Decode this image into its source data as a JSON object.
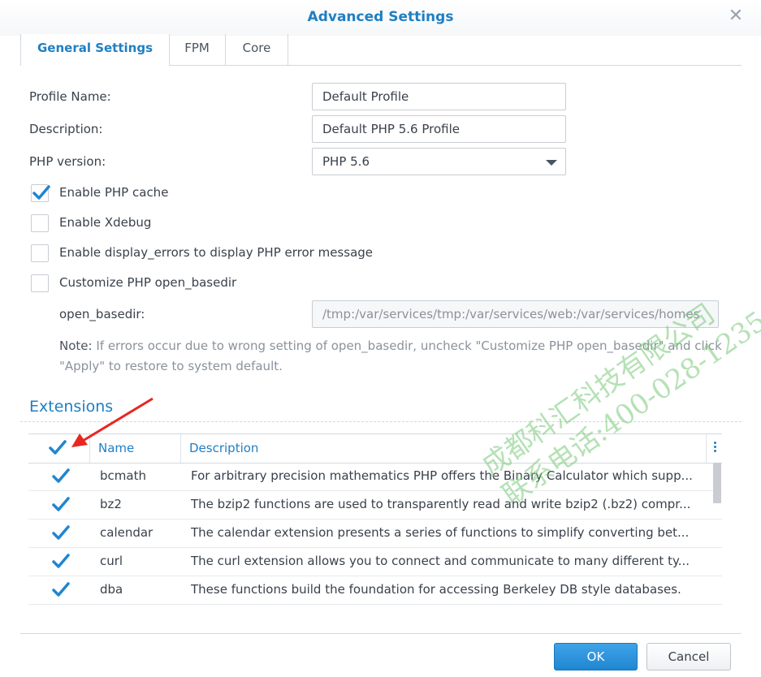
{
  "window": {
    "title": "Advanced Settings"
  },
  "tabs": [
    {
      "label": "General Settings",
      "active": true
    },
    {
      "label": "FPM",
      "active": false
    },
    {
      "label": "Core",
      "active": false
    }
  ],
  "form": {
    "profile_name_label": "Profile Name:",
    "profile_name_value": "Default Profile",
    "description_label": "Description:",
    "description_value": "Default PHP 5.6 Profile",
    "php_version_label": "PHP version:",
    "php_version_value": "PHP 5.6",
    "options": [
      {
        "label": "Enable PHP cache",
        "checked": true
      },
      {
        "label": "Enable Xdebug",
        "checked": false
      },
      {
        "label": "Enable display_errors to display PHP error message",
        "checked": false
      },
      {
        "label": "Customize PHP open_basedir",
        "checked": false
      }
    ],
    "open_basedir_label": "open_basedir:",
    "open_basedir_value": "/tmp:/var/services/tmp:/var/services/web:/var/services/homes",
    "note_head": "Note:",
    "note_line1": "If errors occur due to wrong setting of open_basedir, uncheck \"Customize PHP open_basedir\" and click",
    "note_line2": "\"Apply\" to restore to system default."
  },
  "extensions": {
    "title": "Extensions",
    "columns": [
      "Name",
      "Description"
    ],
    "all_checked": true,
    "rows": [
      {
        "checked": true,
        "name": "bcmath",
        "description": "For arbitrary precision mathematics PHP offers the Binary Calculator which supp..."
      },
      {
        "checked": true,
        "name": "bz2",
        "description": "The bzip2 functions are used to transparently read and write bzip2 (.bz2) compr..."
      },
      {
        "checked": true,
        "name": "calendar",
        "description": "The calendar extension presents a series of functions to simplify converting bet..."
      },
      {
        "checked": true,
        "name": "curl",
        "description": "The curl extension allows you to connect and communicate to many different ty..."
      },
      {
        "checked": true,
        "name": "dba",
        "description": "These functions build the foundation for accessing Berkeley DB style databases."
      }
    ]
  },
  "buttons": {
    "ok": "OK",
    "cancel": "Cancel"
  },
  "watermark": {
    "line1": "成都科汇科技有限公司",
    "line2": "联系电话:400-028-1235"
  },
  "colors": {
    "accent": "#1f7fc3",
    "annotation_arrow": "#e8261f"
  }
}
